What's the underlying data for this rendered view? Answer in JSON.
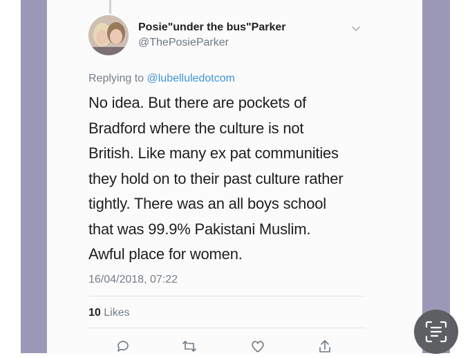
{
  "tweet": {
    "display_name": "Posie\"under the bus\"Parker",
    "handle": "@ThePosieParker",
    "replying_prefix": "Replying to ",
    "replying_to": "@lubelluledotcom",
    "text": "No idea.  But there are pockets of\nBradford where the culture is not\nBritish. Like many ex pat communities\nthey hold on to their past culture rather\ntightly.  There was an all boys school\nthat was 99.9% Pakistani Muslim.\nAwful place for women.",
    "timestamp": "16/04/2018, 07:22",
    "likes_count": "10",
    "likes_label": "Likes"
  },
  "icons": {
    "menu": "chevron-down-icon",
    "reply": "reply-icon",
    "retweet": "retweet-icon",
    "like": "heart-icon",
    "share": "share-icon",
    "scan": "text-scan-icon"
  },
  "colors": {
    "side_bars": "#9b98b7",
    "link": "#3e95d6",
    "secondary_text": "#747d86"
  }
}
